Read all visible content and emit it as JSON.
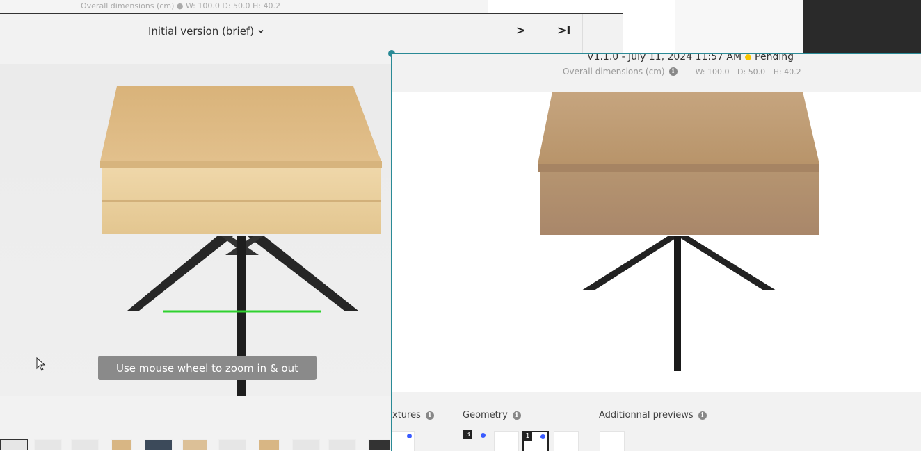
{
  "background": {
    "strip_text": "Overall dimensions (cm) ● W: 100.0 D: 50.0 H: 40.2"
  },
  "left": {
    "version_label": "Initial version (brief)",
    "next_label": ">",
    "last_label": ">I",
    "zoom_hint": "Use mouse wheel to zoom in & out",
    "highlight_color": "#2fd12f"
  },
  "right": {
    "version_text": "V1.1.0 - July 11, 2024 11:57 AM",
    "status": "Pending",
    "status_color": "#f5c400",
    "dims_label": "Overall dimensions (cm)",
    "width": "W: 100.0",
    "depth": "D: 50.0",
    "height": "H: 40.2",
    "sections": {
      "textures": "xtures",
      "geometry": "Geometry",
      "previews": "Additionnal previews"
    },
    "geometry_badges": [
      "3",
      "1"
    ],
    "accent": "#2a8a96"
  },
  "icons": {
    "info": "info-icon",
    "cursor": "cursor-icon",
    "chevron": "chevron-down-icon"
  }
}
